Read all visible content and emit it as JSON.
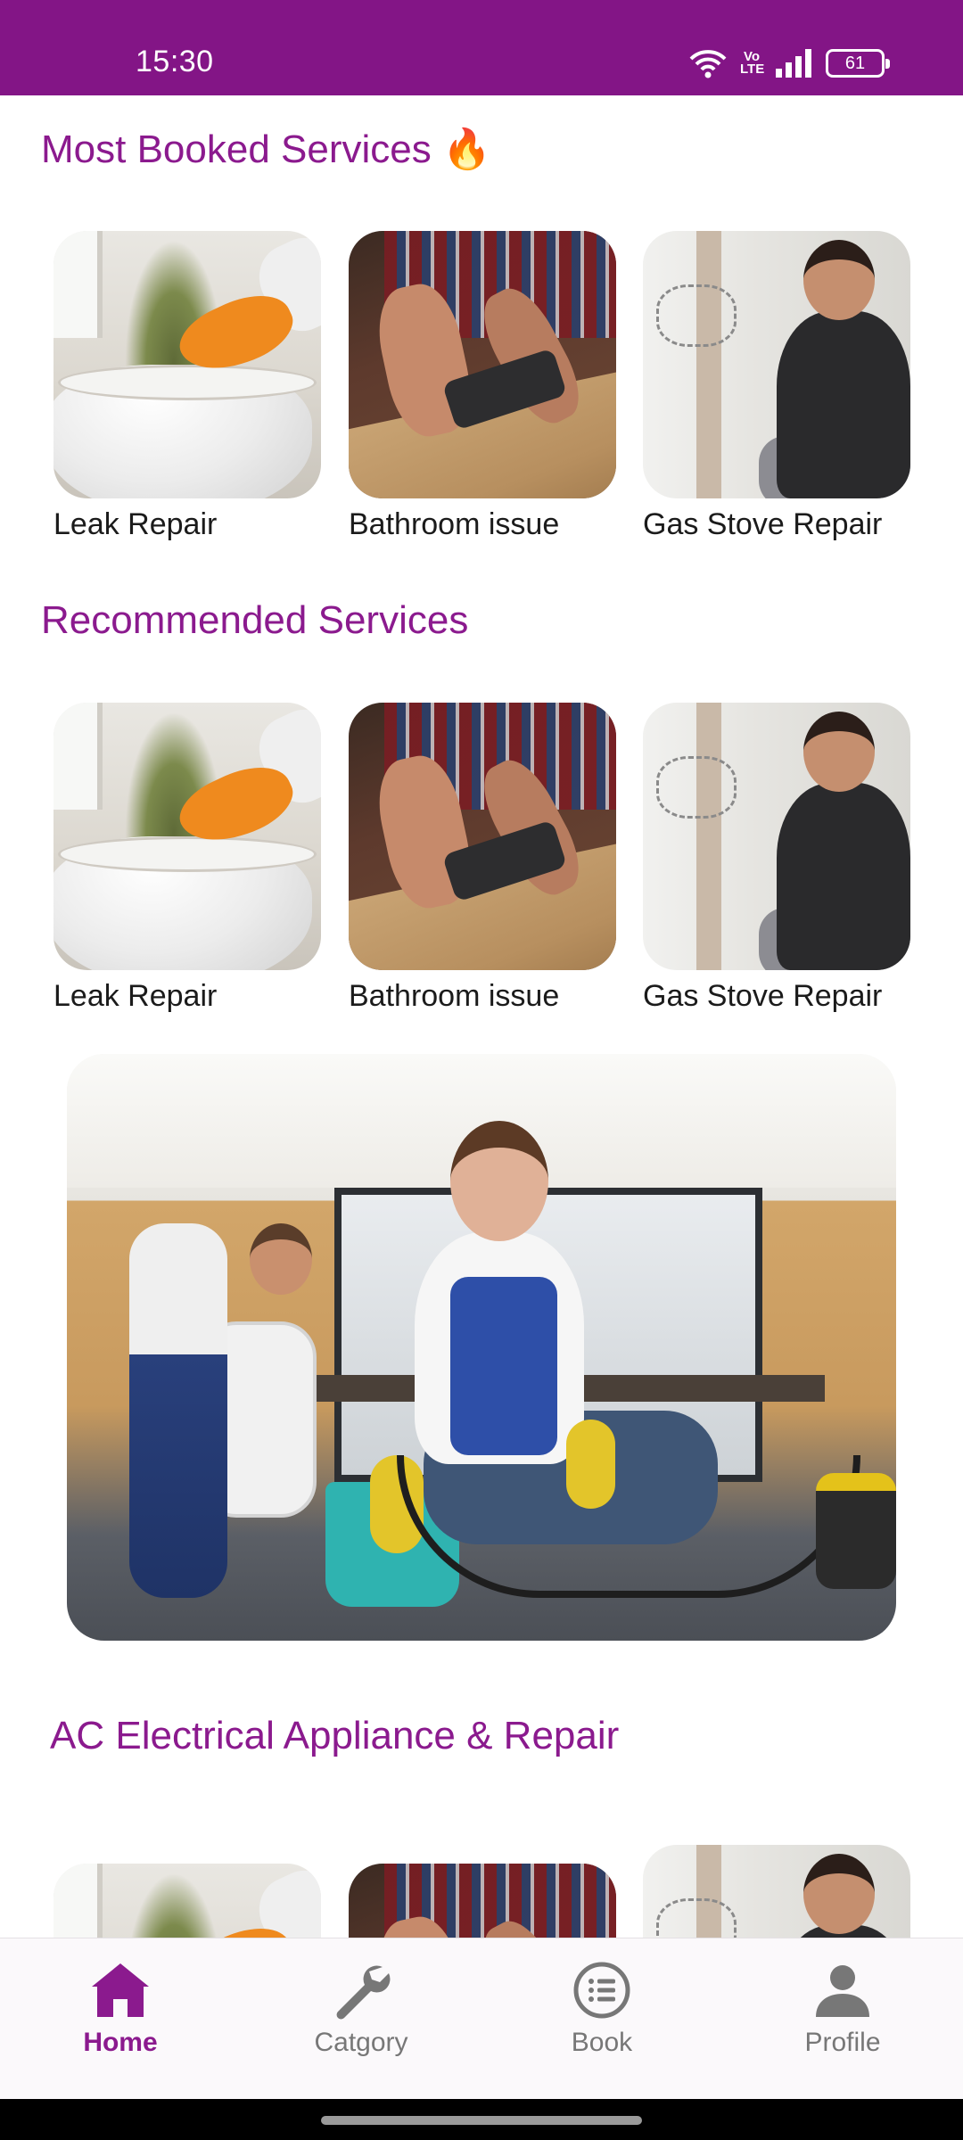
{
  "status_bar": {
    "time": "15:30",
    "network_label": "Vo LTE",
    "battery": "61",
    "bg_color": "#831586"
  },
  "sections": {
    "most_booked": {
      "title": "Most Booked Services 🔥",
      "items": [
        {
          "label": "Leak Repair",
          "image": "toilet-cleaning-image"
        },
        {
          "label": "Bathroom issue",
          "image": "carpenter-planing-image"
        },
        {
          "label": "Gas Stove Repair",
          "image": "electrician-image"
        }
      ]
    },
    "recommended": {
      "title": "Recommended Services",
      "items": [
        {
          "label": "Leak Repair",
          "image": "toilet-cleaning-image"
        },
        {
          "label": "Bathroom issue",
          "image": "carpenter-planing-image"
        },
        {
          "label": "Gas Stove Repair",
          "image": "electrician-image"
        }
      ]
    },
    "ac_repair": {
      "title": "AC Electrical Appliance & Repair",
      "items": [
        {
          "label": "",
          "image": "toilet-cleaning-image"
        },
        {
          "label": "",
          "image": "carpenter-planing-image"
        },
        {
          "label": "",
          "image": "electrician-image"
        }
      ]
    }
  },
  "banner": {
    "image": "office-cleaning-banner-image"
  },
  "bottom_nav": {
    "items": [
      {
        "label": "Home",
        "icon": "home-icon",
        "active": true
      },
      {
        "label": "Catgory",
        "icon": "wrench-icon",
        "active": false
      },
      {
        "label": "Book",
        "icon": "list-icon",
        "active": false
      },
      {
        "label": "Profile",
        "icon": "person-icon",
        "active": false
      }
    ]
  },
  "colors": {
    "accent": "#8b1a8e",
    "inactive": "#777777"
  }
}
